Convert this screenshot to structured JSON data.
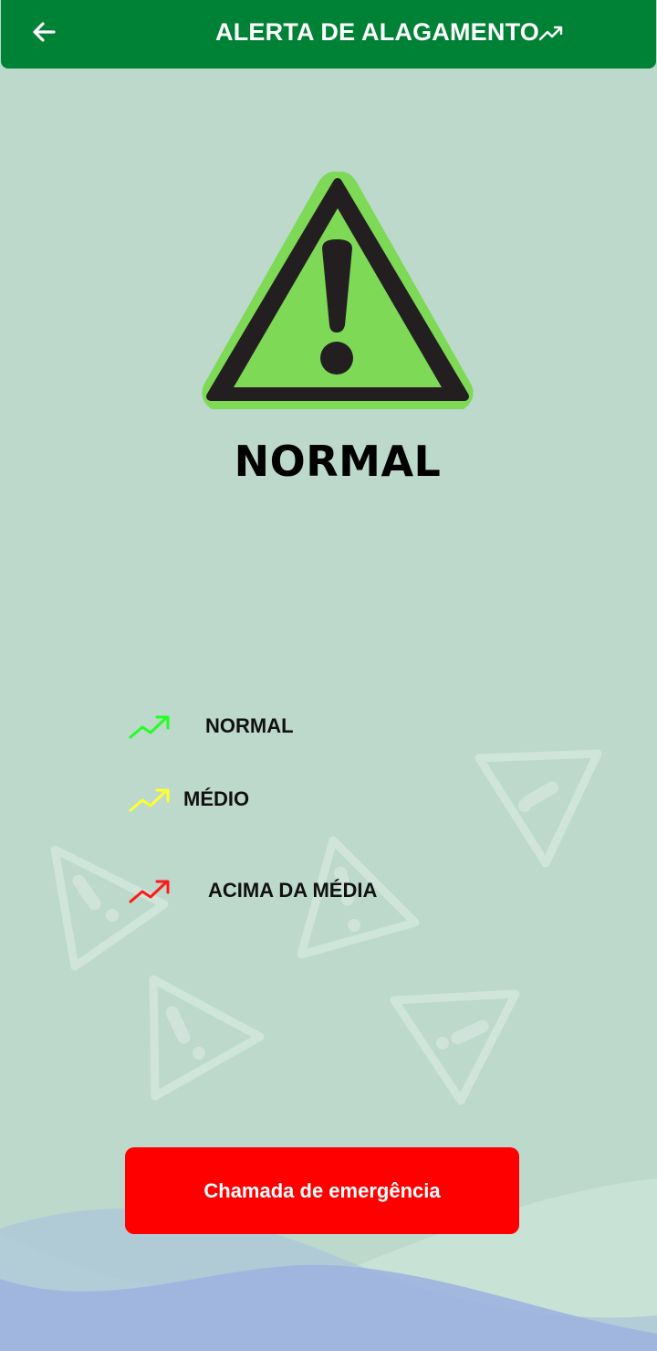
{
  "header": {
    "title": "ALERTA DE ALAGAMENTO",
    "back_icon": "arrow-left-icon",
    "trend_icon": "trending-up-icon"
  },
  "status": {
    "level": "NORMAL",
    "icon": "warning-triangle-icon",
    "color": "#7ed957"
  },
  "legend": [
    {
      "label": "NORMAL",
      "color": "#22ff22",
      "icon": "trending-up-icon"
    },
    {
      "label": "MÉDIO",
      "color": "#ffff33",
      "icon": "trending-up-icon"
    },
    {
      "label": "ACIMA DA MÉDIA",
      "color": "#ff1a1a",
      "icon": "trending-up-icon"
    }
  ],
  "emergency_button": {
    "label": "Chamada de emergência",
    "color": "#ff0000"
  },
  "colors": {
    "app_bar": "#008236",
    "background": "#bcd9cb"
  }
}
